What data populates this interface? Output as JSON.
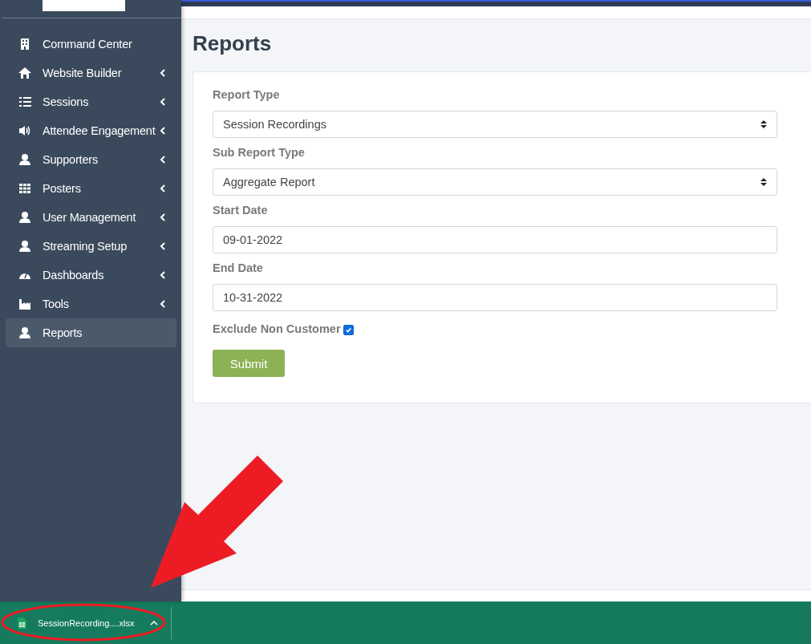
{
  "sidebar": {
    "items": [
      {
        "label": "Command Center",
        "submenu": false,
        "selected": false
      },
      {
        "label": "Website Builder",
        "submenu": true,
        "selected": false
      },
      {
        "label": "Sessions",
        "submenu": true,
        "selected": false
      },
      {
        "label": "Attendee Engagement",
        "submenu": true,
        "selected": false
      },
      {
        "label": "Supporters",
        "submenu": true,
        "selected": false
      },
      {
        "label": "Posters",
        "submenu": true,
        "selected": false
      },
      {
        "label": "User Management",
        "submenu": true,
        "selected": false
      },
      {
        "label": "Streaming Setup",
        "submenu": true,
        "selected": false
      },
      {
        "label": "Dashboards",
        "submenu": true,
        "selected": false
      },
      {
        "label": "Tools",
        "submenu": true,
        "selected": false
      },
      {
        "label": "Reports",
        "submenu": false,
        "selected": true
      }
    ]
  },
  "page": {
    "title": "Reports"
  },
  "form": {
    "fields": [
      {
        "kind": "select",
        "label": "Report Type",
        "value": "Session Recordings"
      },
      {
        "kind": "select",
        "label": "Sub Report Type",
        "value": "Aggregate Report"
      },
      {
        "kind": "text",
        "label": "Start Date",
        "value": "09-01-2022"
      },
      {
        "kind": "text",
        "label": "End Date",
        "value": "10-31-2022"
      }
    ],
    "checkbox": {
      "label": "Exclude Non Customer",
      "checked": true
    },
    "submit": "Submit"
  },
  "download_bar": {
    "file": "SessionRecording....xlsx"
  }
}
